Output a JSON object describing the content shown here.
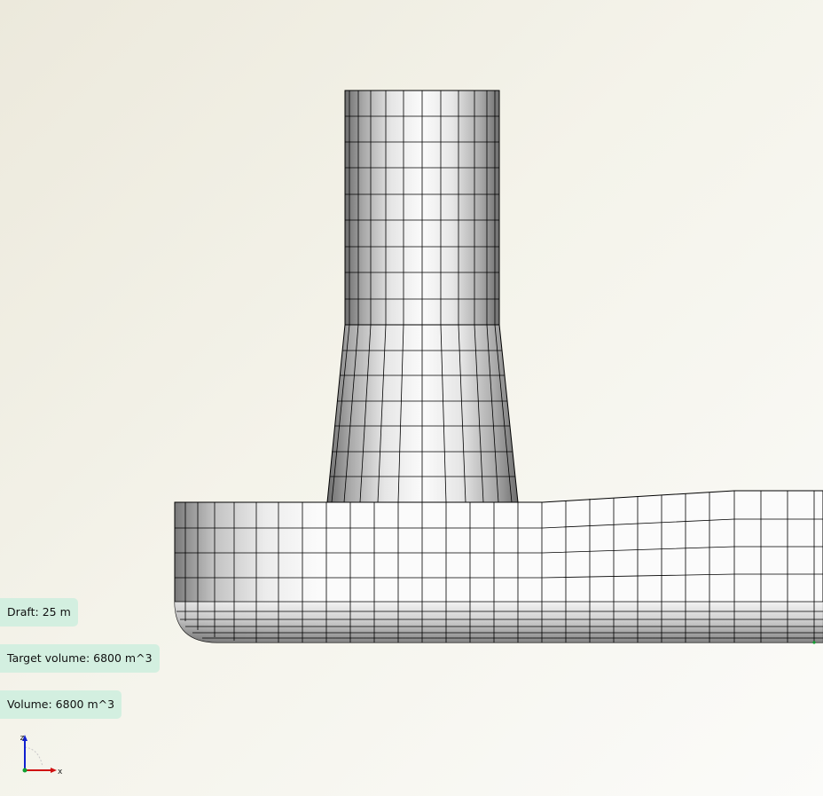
{
  "viewer": {
    "labels": {
      "draft": "Draft: 25 m",
      "target_volume": "Target volume: 6800 m^3",
      "volume": "Volume: 6800 m^3"
    },
    "axes": {
      "z_label": "z",
      "x_label": "x"
    }
  },
  "colors": {
    "label_bg": "#d3efe0",
    "mesh_line": "#000000",
    "axis_z": "#1020d0",
    "axis_x": "#d01010",
    "axis_origin": "#10a030"
  }
}
